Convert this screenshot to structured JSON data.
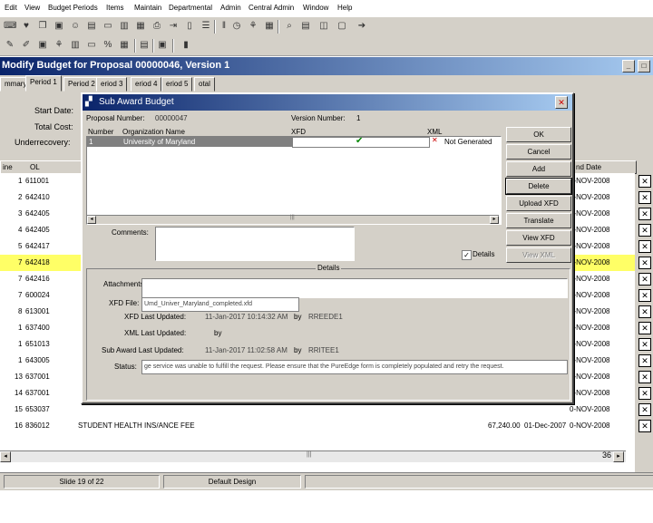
{
  "menu": [
    "Edit",
    "View",
    "Budget Periods",
    "Items",
    "Maintain",
    "Departmental",
    "Admin",
    "Central Admin",
    "Window",
    "Help"
  ],
  "toolbar1_icons": [
    "keyboard-icon",
    "heart-icon",
    "copy-icon",
    "save-icon",
    "users-icon",
    "folder-icon",
    "doc-icon",
    "chart-icon",
    "open-icon",
    "print-icon",
    "exit-icon",
    "page-icon",
    "list-icon",
    "clock-icon",
    "tree-icon",
    "search-icon",
    "table-icon",
    "layout-icon",
    "grid-icon",
    "arrow-icon"
  ],
  "toolbar2_icons": [
    "new-icon",
    "edit-icon",
    "open-icon",
    "tree-icon",
    "percent-icon",
    "calc-icon",
    "grid-icon",
    "save-icon",
    "book-icon"
  ],
  "window": {
    "title": "Modify Budget for Proposal 00000046, Version 1"
  },
  "tabs": [
    "mmary",
    "Period 1",
    "Period 2",
    "eriod 3",
    "eriod 4",
    "eriod 5",
    "otal"
  ],
  "main": {
    "start_date_label": "Start Date:",
    "total_cost_label": "Total Cost:",
    "underrecovery_label": "Underrecovery:",
    "col_line": "ine",
    "col_ol": "OL",
    "col_end_date": "nd Date",
    "rows": [
      {
        "n": "1",
        "code": "611001",
        "end": "0-NOV-2008"
      },
      {
        "n": "2",
        "code": "642410",
        "end": "0-NOV-2008"
      },
      {
        "n": "3",
        "code": "642405",
        "end": "0-NOV-2008"
      },
      {
        "n": "4",
        "code": "642405",
        "end": "0-NOV-2008"
      },
      {
        "n": "5",
        "code": "642417",
        "end": "0-NOV-2008"
      },
      {
        "n": "7",
        "code": "642418",
        "end": "0-NOV-2008"
      },
      {
        "n": "7",
        "code": "642416",
        "end": "0-NOV-2008"
      },
      {
        "n": "7",
        "code": "600024",
        "end": "0-NOV-2008"
      },
      {
        "n": "8",
        "code": "613001",
        "end": "0-NOV-2008"
      },
      {
        "n": "1",
        "code": "637400",
        "end": "0-NOV-2008"
      },
      {
        "n": "1",
        "code": "651013",
        "end": "0-NOV-2008"
      },
      {
        "n": "1",
        "code": "643005",
        "end": "0-NOV-2008"
      },
      {
        "n": "13",
        "code": "637001",
        "end": "0-NOV-2008"
      },
      {
        "n": "14",
        "code": "637001",
        "end": "0-NOV-2008"
      },
      {
        "n": "15",
        "code": "653037",
        "end": "0-NOV-2008"
      },
      {
        "n": "16",
        "code": "836012",
        "end": "0-NOV-2008"
      }
    ],
    "last_row_desc": "STUDENT HEALTH INS/ANCE FEE",
    "last_row_amount": "67,240.00",
    "last_row_start": "01-Dec-2007",
    "page_number": "36"
  },
  "status": {
    "slide": "Slide 19 of 22",
    "design": "Default Design"
  },
  "dialog": {
    "title": "Sub Award Budget",
    "proposal_number_label": "Proposal Number:",
    "proposal_number": "00000047",
    "version_number_label": "Version Number:",
    "version_number": "1",
    "col_number": "Number",
    "col_org": "Organization Name",
    "col_xfd": "XFD",
    "col_xml": "XML",
    "row": {
      "number": "1",
      "org": "University of Maryland",
      "xfd_check": "✔",
      "xml_status": "Not Generated"
    },
    "buttons": {
      "ok": "OK",
      "cancel": "Cancel",
      "add": "Add",
      "delete": "Delete",
      "upload": "Upload XFD",
      "translate": "Translate",
      "view_xfd": "View XFD",
      "view_xml": "View XML"
    },
    "comments_label": "Comments:",
    "details_label": "Details",
    "details_header": "Details",
    "attachments_label": "Attachments:",
    "xfd_file_label": "XFD File:",
    "xfd_file": "Umd_Univer_Maryland_completed.xfd",
    "xfd_last_updated_label": "XFD  Last Updated:",
    "xfd_last_updated": "11-Jan-2017 10:14:32 AM",
    "by_label": "by",
    "xfd_by": "RREEDE1",
    "xml_last_updated_label": "XML  Last Updated:",
    "sub_award_last_updated_label": "Sub Award  Last Updated:",
    "sub_award_last_updated": "11-Jan-2017 11:02:58 AM",
    "sub_award_by": "RRITEE1",
    "status_label": "Status:",
    "status_text": "ge service was unable to fulfill the request.  Please ensure that the PureEdge form is completely populated and retry the request."
  }
}
